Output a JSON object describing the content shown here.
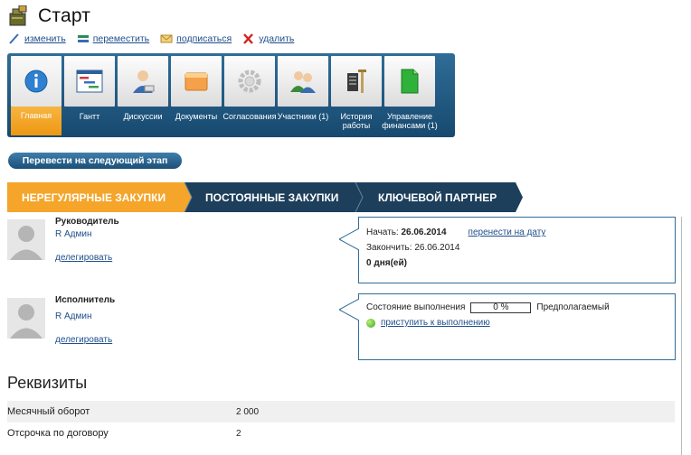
{
  "page": {
    "title": "Старт"
  },
  "actions": [
    {
      "key": "edit",
      "label": "изменить",
      "icon": "pencil-icon"
    },
    {
      "key": "move",
      "label": "переместить",
      "icon": "move-arrows-icon"
    },
    {
      "key": "subscribe",
      "label": "подписаться",
      "icon": "envelope-icon"
    },
    {
      "key": "delete",
      "label": "удалить",
      "icon": "delete-x-icon"
    }
  ],
  "tabs": [
    {
      "label": "Главная",
      "icon": "info-icon",
      "active": true
    },
    {
      "label": "Гантт",
      "icon": "gantt-chart-icon"
    },
    {
      "label": "Дискуссии",
      "icon": "discussion-user-icon"
    },
    {
      "label": "Документы",
      "icon": "folder-icon"
    },
    {
      "label": "Согласования",
      "icon": "gear-icon"
    },
    {
      "label": "Участники (1)",
      "icon": "participants-icon"
    },
    {
      "label": "История работы",
      "icon": "history-icon"
    },
    {
      "label": "Управление финансами (1)",
      "icon": "finance-document-icon"
    }
  ],
  "next_stage_button": "Перевести на следующий этап",
  "stages": [
    {
      "label": "Нерегулярные закупки",
      "active": true
    },
    {
      "label": "Постоянные закупки",
      "active": false
    },
    {
      "label": "Ключевой партнер",
      "active": false
    }
  ],
  "manager": {
    "role": "Руководитель",
    "name": "R Админ",
    "delegate": "делегировать"
  },
  "executor": {
    "role": "Исполнитель",
    "name": "R Админ",
    "delegate": "делегировать"
  },
  "schedule": {
    "start_label": "Начать:",
    "start_date": "26.06.2014",
    "reschedule_link": "перенести на дату",
    "end_label": "Закончить:",
    "end_date": "26.06.2014",
    "duration": "0 дня(ей)"
  },
  "progress": {
    "label": "Состояние выполнения",
    "value": "0 %",
    "expected_label": "Предполагаемый",
    "start_link": "приступить к выполнению"
  },
  "requisites": {
    "title": "Реквизиты",
    "rows": [
      {
        "key": "Месячный оборот",
        "value": "2 000"
      },
      {
        "key": "Отсрочка по договору",
        "value": "2"
      }
    ]
  },
  "colors": {
    "accent_blue": "#2f6d98",
    "active_orange": "#f4a52a",
    "stage_dark": "#1d3f5c"
  }
}
